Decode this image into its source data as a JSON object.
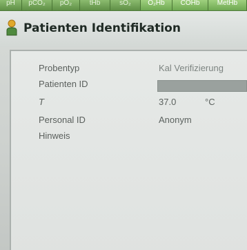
{
  "tabs": [
    {
      "label": "pH"
    },
    {
      "label": "pCO₂"
    },
    {
      "label": "pO₂"
    },
    {
      "label": "tHb"
    },
    {
      "label": "sO₂"
    },
    {
      "label": "O₂Hb"
    },
    {
      "label": "COHb"
    },
    {
      "label": "MetHb"
    }
  ],
  "title": {
    "text": "Patienten Identifikation",
    "icon": "person-icon"
  },
  "fields": {
    "probentyp": {
      "label": "Probentyp",
      "value": "Kal Verifizierung"
    },
    "patienten_id": {
      "label": "Patienten ID",
      "value": ""
    },
    "temperature": {
      "label": "T",
      "value": "37.0",
      "unit": "°C"
    },
    "personal_id": {
      "label": "Personal ID",
      "value": "Anonym"
    },
    "hinweis": {
      "label": "Hinweis",
      "value": ""
    }
  },
  "colors": {
    "tab_green": "#6e9a5a",
    "title_text": "#1f2a24"
  }
}
